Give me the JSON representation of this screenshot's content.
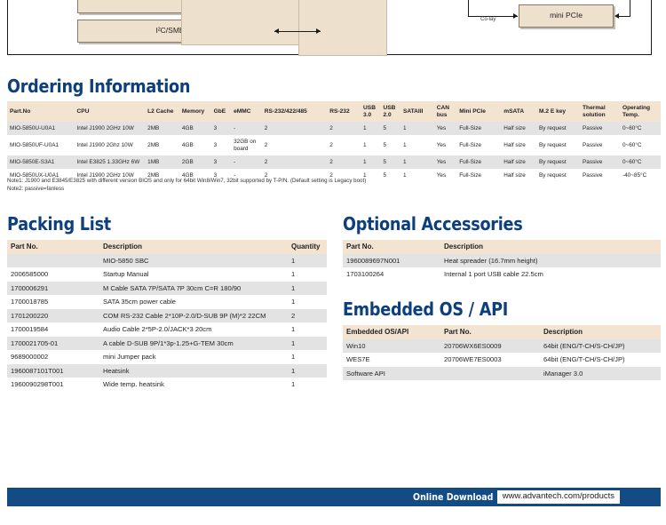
{
  "diagram": {
    "boxes": [
      {
        "label": "I²C/SMBus"
      },
      {
        "label": "mini PCIe"
      }
    ],
    "edge_labels": [
      "Co-lay"
    ]
  },
  "sections": {
    "ordering": "Ordering Information",
    "packing": "Packing List",
    "accessories": "Optional Accessories",
    "embedded": "Embedded OS / API"
  },
  "ordering": {
    "columns": [
      "Part.No",
      "CPU",
      "L2 Cache",
      "Memory",
      "GbE",
      "eMMC",
      "RS-232/422/485",
      "RS-232",
      "USB 3.0",
      "USB 2.0",
      "SATAIII",
      "CAN bus",
      "Mini PCIe",
      "mSATA",
      "M.2 E key",
      "Thermal solution",
      "Operating Temp."
    ],
    "rows": [
      [
        "MIO-5850U-U0A1",
        "Intel J1900 2GHz 10W",
        "2MB",
        "4GB",
        "3",
        "-",
        "2",
        "2",
        "1",
        "5",
        "1",
        "Yes",
        "Full-Size",
        "Half size",
        "By request",
        "Passive",
        "0~60°C"
      ],
      [
        "MIO-5850UF-U0A1",
        "Intel J1900 2Ghz 10W",
        "2MB",
        "4GB",
        "3",
        "32GB on board",
        "2",
        "2",
        "1",
        "5",
        "1",
        "Yes",
        "Full-Size",
        "Half size",
        "By request",
        "Passive",
        "0~60°C"
      ],
      [
        "MIO-5850E-S3A1",
        "Intel E3825 1.33GHz 6W",
        "1MB",
        "2GB",
        "3",
        "-",
        "2",
        "2",
        "1",
        "5",
        "1",
        "Yes",
        "Full-Size",
        "Half size",
        "By request",
        "Passive",
        "0~60°C"
      ],
      [
        "MIO-5850UX-U0A1",
        "Intel J1900 2GHz 10W",
        "2MB",
        "4GB",
        "3",
        "-",
        "2",
        "2",
        "1",
        "5",
        "1",
        "Yes",
        "Full-Size",
        "Half size",
        "By request",
        "Passive",
        "-40~85°C"
      ]
    ],
    "note1": "Note1: J1900 and E3845/E3825 with different version BIOS and only for 64bit Win8/Win7, 32bit supported by T-P/N. (Default setting is Legacy boot)",
    "note2": "Note2: passive=fanless"
  },
  "packing": {
    "columns": [
      "Part No.",
      "Description",
      "Quantity"
    ],
    "rows": [
      [
        "",
        "MIO-5850 SBC",
        "1"
      ],
      [
        "2006585000",
        "Startup Manual",
        "1"
      ],
      [
        "1700006291",
        "M Cable SATA 7P/SATA 7P 30cm C=R 180/90",
        "1"
      ],
      [
        "1700018785",
        "SATA 35cm power cable",
        "1"
      ],
      [
        "1701200220",
        "COM RS-232 Cable 2*10P-2.0/D-SUB 9P (M)*2 22CM",
        "2"
      ],
      [
        "1700019584",
        "Audio Cable 2*5P-2.0/JACK*3 20cm",
        "1"
      ],
      [
        "1700021705-01",
        "A cable D-SUB 9P/1*3p-1.25+G-TEM 30cm",
        "1"
      ],
      [
        "9689000002",
        "mini Jumper pack",
        "1"
      ],
      [
        "1960087101T001",
        "Heatsink",
        "1"
      ],
      [
        "1960090298T001",
        "Wide temp. heatsink",
        "1"
      ]
    ]
  },
  "accessories": {
    "columns": [
      "Part No.",
      "Description"
    ],
    "rows": [
      [
        "1960089697N001",
        "Heat spreader (16.7mm height)"
      ],
      [
        "1703100264",
        "Internal 1 port USB cable 22.5cm"
      ]
    ]
  },
  "embedded": {
    "columns": [
      "Embedded OS/API",
      "Part No.",
      "Description"
    ],
    "rows": [
      [
        "Win10",
        "20706WX6ES0009",
        "64bit (ENG/T-CH/S-CH/JP)"
      ],
      [
        "WES7E",
        "20706WE7ES0003",
        "64bit (ENG/T-CH/S-CH/JP)"
      ],
      [
        "Software API",
        "",
        "iManager 3.0"
      ]
    ]
  },
  "footer": {
    "label": "Online Download",
    "url": "www.advantech.com/products"
  },
  "colors": {
    "heading_blue": "#0d3f7d",
    "footer_blue": "#134b85",
    "table_header_peach": "#f3e3d1",
    "row_alt_gray": "#e3e3e3",
    "diagram_box_tan": "#ede0cd"
  }
}
